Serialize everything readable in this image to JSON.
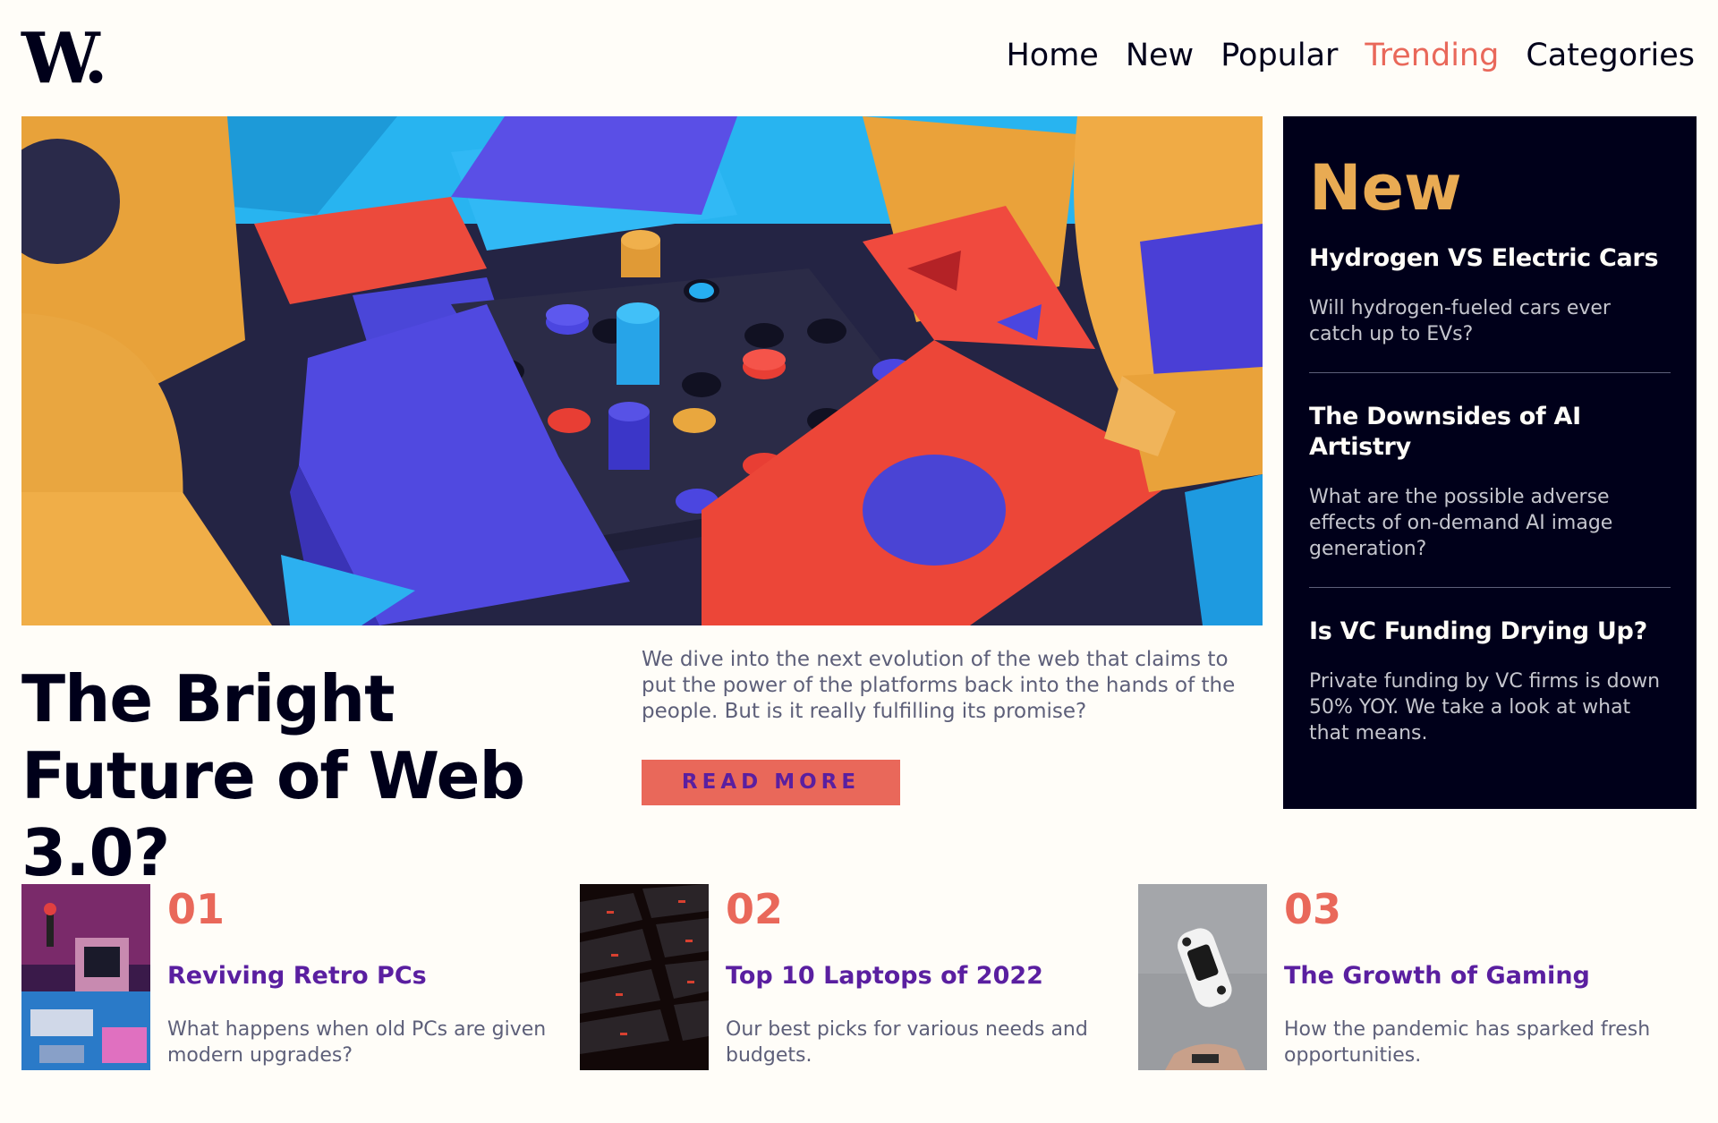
{
  "brand": {
    "logo": "W",
    "logo_dot": "."
  },
  "nav": {
    "items": [
      {
        "label": "Home",
        "active": false
      },
      {
        "label": "New",
        "active": false
      },
      {
        "label": "Popular",
        "active": false
      },
      {
        "label": "Trending",
        "active": true
      },
      {
        "label": "Categories",
        "active": false
      }
    ]
  },
  "hero": {
    "title": "The Bright Future of Web 3.0?",
    "description": "We dive into the next evolution of the web that claims to put the power of the platforms back into the hands of the people. But is it really fulfilling its promise?",
    "button_label": "READ MORE"
  },
  "new_panel": {
    "heading": "New",
    "items": [
      {
        "title": "Hydrogen VS Electric Cars",
        "description": "Will hydrogen-fueled cars ever catch up to EVs?"
      },
      {
        "title": "The Downsides of AI Artistry",
        "description": "What are the possible adverse effects of on-demand AI image generation?"
      },
      {
        "title": "Is VC Funding Drying Up?",
        "description": "Private funding by VC firms is down 50% YOY. We take a look at what that means."
      }
    ]
  },
  "articles": [
    {
      "number": "01",
      "title": "Reviving Retro PCs",
      "description": "What happens when old PCs are given modern upgrades?"
    },
    {
      "number": "02",
      "title": "Top 10 Laptops of 2022",
      "description": "Our best picks for various needs and budgets."
    },
    {
      "number": "03",
      "title": "The Growth of Gaming",
      "description": "How the pandemic has sparked fresh opportunities."
    }
  ],
  "colors": {
    "accent_red": "#e9685a",
    "accent_orange": "#e9ab53",
    "dark_blue": "#00001a",
    "purple": "#5a1fa0",
    "grey_text": "#5d5f79",
    "background": "#fffdf8"
  }
}
